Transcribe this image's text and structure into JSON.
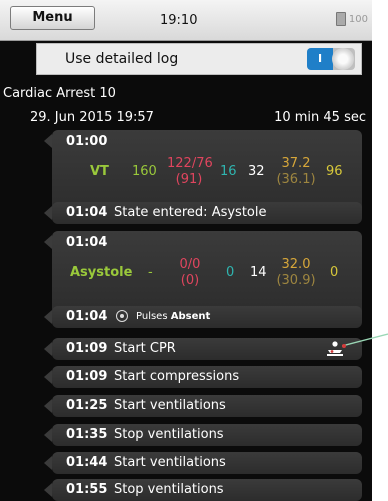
{
  "status_bar": {
    "menu_label": "Menu",
    "time": "19:10",
    "battery_level": "100"
  },
  "settings": {
    "detailed_log_label": "Use detailed log",
    "toggle_on_label": "I"
  },
  "case": {
    "title": "Cardiac Arrest 10",
    "date": "29. Jun 2015 19:57",
    "duration": "10 min 45 sec"
  },
  "log": {
    "vitals_1": {
      "time": "01:00",
      "rhythm": "VT",
      "hr": "160",
      "bp": "122/76",
      "map": "(91)",
      "spo2": "16",
      "rr": "32",
      "temp": "37.2",
      "temp2": "(36.1)",
      "etco2": "96"
    },
    "state_event": {
      "time": "01:04",
      "text": "State entered: Asystole"
    },
    "vitals_2": {
      "time": "01:04",
      "rhythm": "Asystole",
      "hr": "-",
      "bp": "0/0",
      "map": "(0)",
      "spo2": "0",
      "rr": "14",
      "temp": "32.0",
      "temp2": "(30.9)",
      "etco2": "0"
    },
    "pulse_event": {
      "time": "01:04",
      "label": "Pulses",
      "value": "Absent"
    },
    "events": [
      {
        "time": "01:09",
        "text": "Start CPR"
      },
      {
        "time": "01:09",
        "text": "Start compressions"
      },
      {
        "time": "01:25",
        "text": "Start ventilations"
      },
      {
        "time": "01:35",
        "text": "Stop ventilations"
      },
      {
        "time": "01:44",
        "text": "Start ventilations"
      },
      {
        "time": "01:55",
        "text": "Stop ventilations"
      }
    ]
  },
  "colors": {
    "rhythm": "#9ac93b",
    "bp": "#e0455e",
    "spo2": "#2fb5b0",
    "temp": "#d7a73a",
    "etco2": "#d7c83a",
    "toggle_on": "#1f7fc8"
  },
  "icons": {
    "pulse": "pulse-radio-icon",
    "cpr": "cpr-person-icon"
  }
}
